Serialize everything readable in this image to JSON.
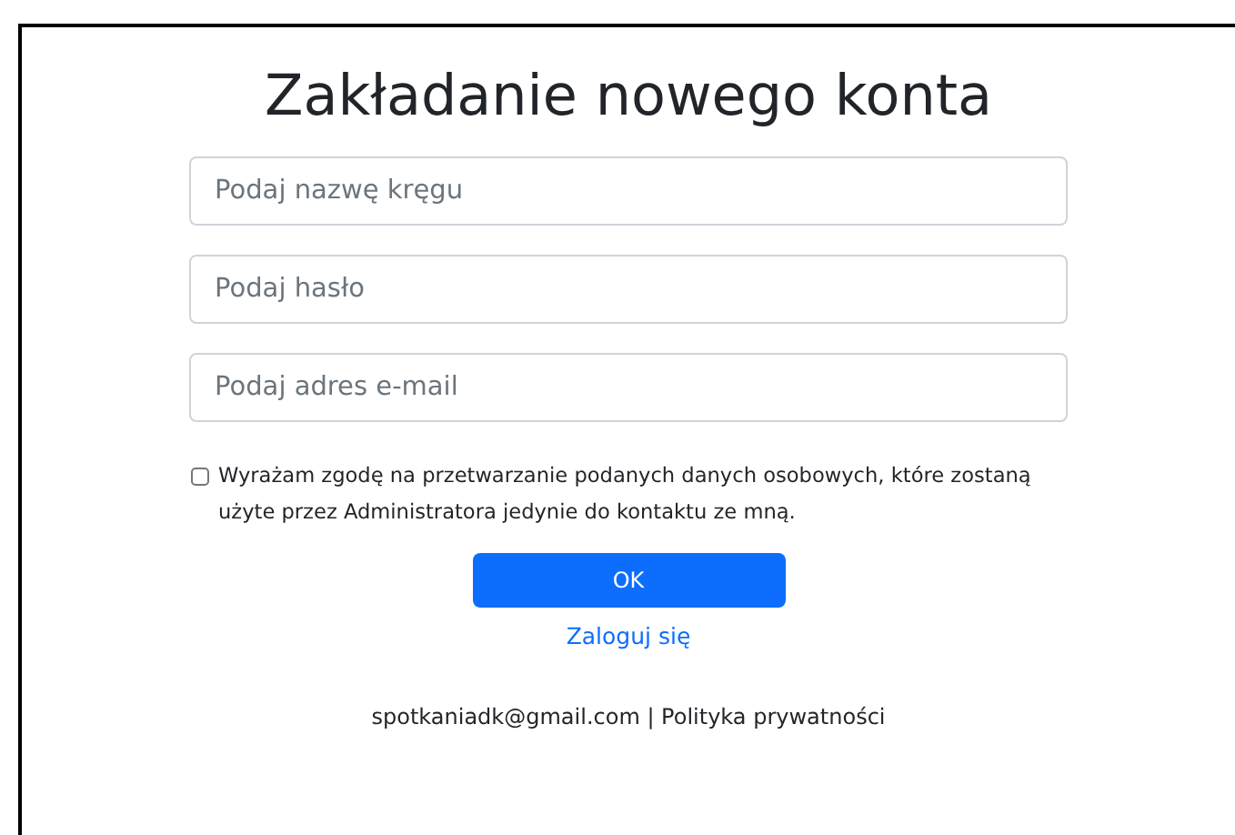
{
  "title": "Zakładanie nowego konta",
  "fields": [
    {
      "placeholder": "Podaj nazwę kręgu"
    },
    {
      "placeholder": "Podaj hasło"
    },
    {
      "placeholder": "Podaj adres e-mail"
    }
  ],
  "consent": {
    "checked": false,
    "label": "Wyrażam zgodę na przetwarzanie podanych danych osobowych, które zostaną użyte przez Administratora jedynie do kontaktu ze mną."
  },
  "submit_button": "OK",
  "login_link": "Zaloguj się",
  "footer": "spotkaniadk@gmail.com | Polityka prywatności"
}
